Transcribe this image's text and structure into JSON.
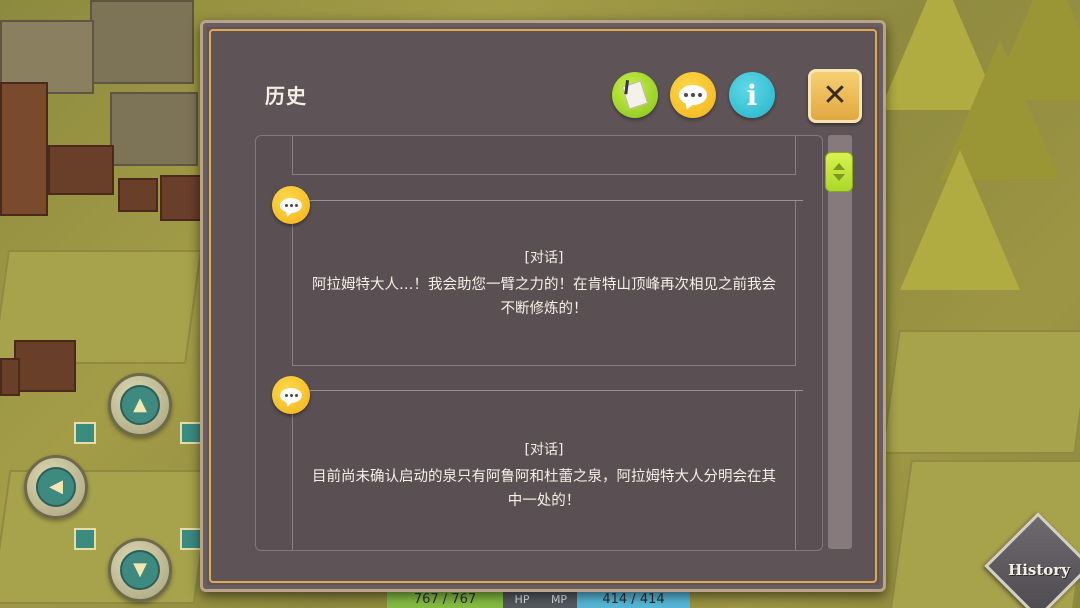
{
  "dialog": {
    "title": "历史",
    "toolbar": [
      {
        "icon": "note-icon"
      },
      {
        "icon": "chat-icon"
      },
      {
        "icon": "info-icon",
        "glyph": "i"
      }
    ],
    "close_glyph": "✕",
    "entries": [
      {
        "tag": "[对话]",
        "text": "阿拉姆特大人…！我会助您一臂之力的！在肯特山顶峰再次相见之前我会不断修炼的！"
      },
      {
        "tag": "[对话]",
        "text": "目前尚未确认启动的泉只有阿鲁阿和杜蕾之泉，阿拉姆特大人分明会在其中一处的！"
      }
    ]
  },
  "hud": {
    "hp_value": "767 / 767",
    "hp_label": "HP",
    "mp_label": "MP",
    "mp_value": "414 / 414",
    "history_button": "History"
  },
  "colors": {
    "dialog_bg": "#5e5356",
    "frame_gold": "#e1a94e",
    "accent_green": "#a9d82a",
    "accent_yellow": "#f2b21c",
    "accent_cyan": "#25b3c8"
  }
}
